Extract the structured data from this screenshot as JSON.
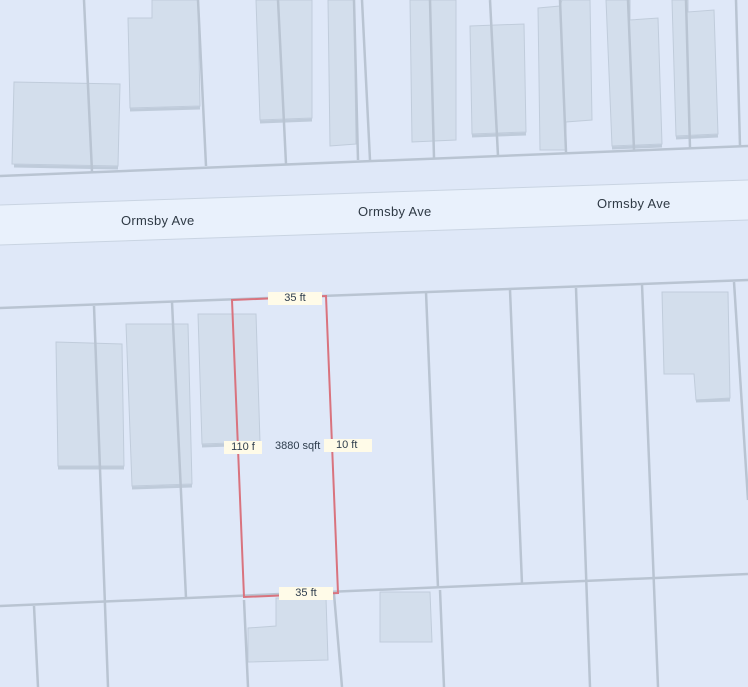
{
  "map": {
    "street_name": "Ormsby Ave",
    "colors": {
      "background": "#dfe8f8",
      "street": "#e9f1fc",
      "building_fill": "#d3deec",
      "building_shadow": "#c0ccdb",
      "lot_line": "#b9c4d2",
      "parcel_outline": "#d9737e",
      "label_background": "#fffbe8"
    }
  },
  "street_labels": [
    "Ormsby Ave",
    "Ormsby Ave",
    "Ormsby Ave"
  ],
  "parcel": {
    "frontage_top": "35 ft",
    "frontage_bottom": "35 ft",
    "depth_left": "110 f",
    "depth_right": "10 ft",
    "area": "3880 sqft"
  }
}
